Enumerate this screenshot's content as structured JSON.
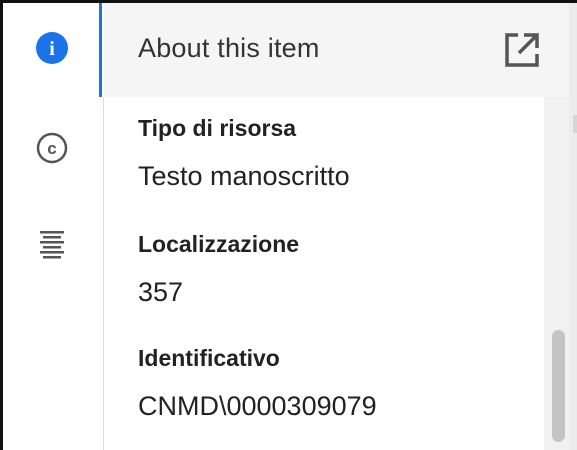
{
  "header": {
    "title": "About this item",
    "external_icon": "open-in-new-icon"
  },
  "rail": {
    "items": [
      {
        "icon": "info-icon",
        "active": true,
        "glyph": "i"
      },
      {
        "icon": "copyright-icon",
        "active": false,
        "glyph": "c"
      },
      {
        "icon": "text-lines-icon",
        "active": false
      }
    ]
  },
  "fields": [
    {
      "label": "Tipo di risorsa",
      "value": "Testo manoscritto"
    },
    {
      "label": "Localizzazione",
      "value": "357"
    },
    {
      "label": "Identificativo",
      "value": "CNMD\\0000309079"
    }
  ],
  "colors": {
    "accent": "#1a73e8",
    "header_bg": "#f5f5f5",
    "text": "#222222"
  }
}
